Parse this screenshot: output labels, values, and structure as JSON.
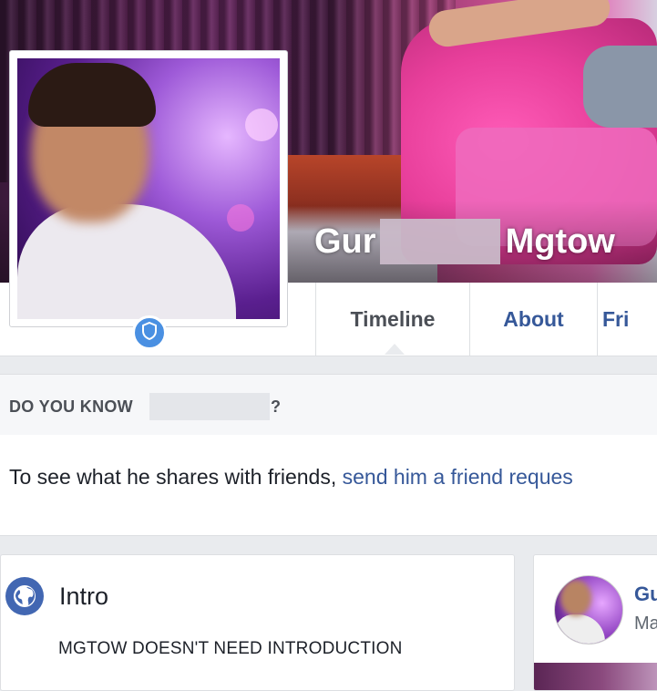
{
  "profile": {
    "name_first": "Gur",
    "name_last": "Mgtow"
  },
  "tabs": [
    {
      "label": "Timeline",
      "active": true
    },
    {
      "label": "About",
      "active": false
    },
    {
      "label": "Fri",
      "active": false
    }
  ],
  "do_you_know": {
    "prefix": "DO YOU KNOW",
    "suffix": "?"
  },
  "share_prompt": {
    "text": "To see what he shares with friends, ",
    "link": "send him a friend reques"
  },
  "intro": {
    "title": "Intro",
    "bio": "MGTOW DOESN'T NEED INTRODUCTION"
  },
  "side_card": {
    "name": "Gu",
    "sub": "Ma"
  },
  "colors": {
    "link": "#365899",
    "badge": "#4a90e2",
    "globe": "#4267b2"
  },
  "icons": [
    "shield-icon",
    "globe-icon"
  ]
}
